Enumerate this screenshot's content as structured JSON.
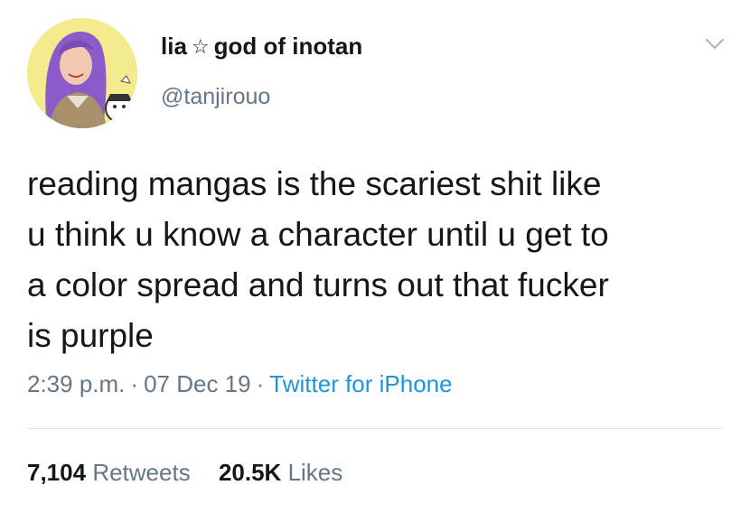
{
  "author": {
    "name": "lia",
    "name_suffix": "god of inotan",
    "star_glyph": "☆",
    "handle": "@tanjirouo"
  },
  "tweet": {
    "lines": [
      "reading mangas is the scariest shit like",
      "u think u know a character until u get to",
      "a color spread and turns out that fucker",
      "is purple"
    ]
  },
  "meta": {
    "time": "2:39 p.m.",
    "date": "07 Dec 19",
    "source": "Twitter for iPhone",
    "separator": "·"
  },
  "stats": {
    "retweets_count": "7,104",
    "retweets_label": "Retweets",
    "likes_count": "20.5K",
    "likes_label": "Likes"
  },
  "colors": {
    "link": "#1b95e0",
    "secondary_text": "#657786",
    "avatar_bg": "#f4ea8e",
    "hair": "#8a5bc9"
  },
  "icons": {
    "menu": "chevron-down-icon",
    "avatar": "avatar"
  }
}
